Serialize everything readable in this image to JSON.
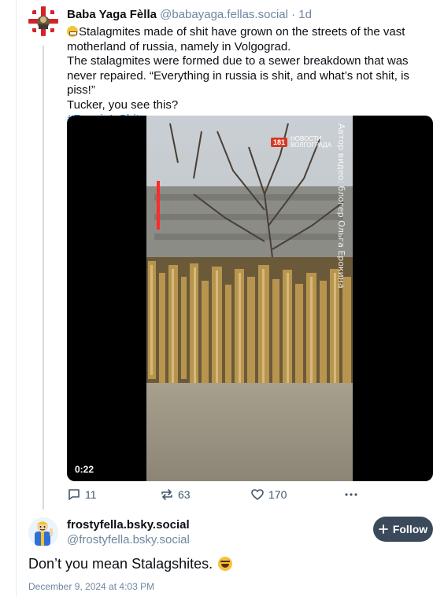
{
  "post": {
    "author_name": "Baba Yaga Fèlla",
    "author_handle": "@babayaga.fellas.social",
    "separator": " · ",
    "age": "1d",
    "text_line1": "Stalagmites made of shit have grown on the streets of the vast motherland of russia, namely in Volgograd.",
    "text_line2": "The stalagmites were formed due to a sewer breakdown that was never repaired. “Everything in russia is shit, and what’s not shit, is piss!”",
    "text_line3": "Tucker, you see this?",
    "hashtag": "#RussiaIsShit",
    "video": {
      "duration": "0:22",
      "watermark": "Автор видео: блогер Ольга Ерокина",
      "badge": "181",
      "badge_text": "НОВОСТИ ВОЛГОГРАДА"
    },
    "actions": {
      "replies": "11",
      "reposts": "63",
      "likes": "170"
    }
  },
  "reply": {
    "author_name": "frostyfella.bsky.social",
    "author_handle": "@frostyfella.bsky.social",
    "follow_label": "Follow",
    "text": "Don’t you mean Stalagshites.",
    "date": "December 9, 2024 at 4:03 PM"
  }
}
